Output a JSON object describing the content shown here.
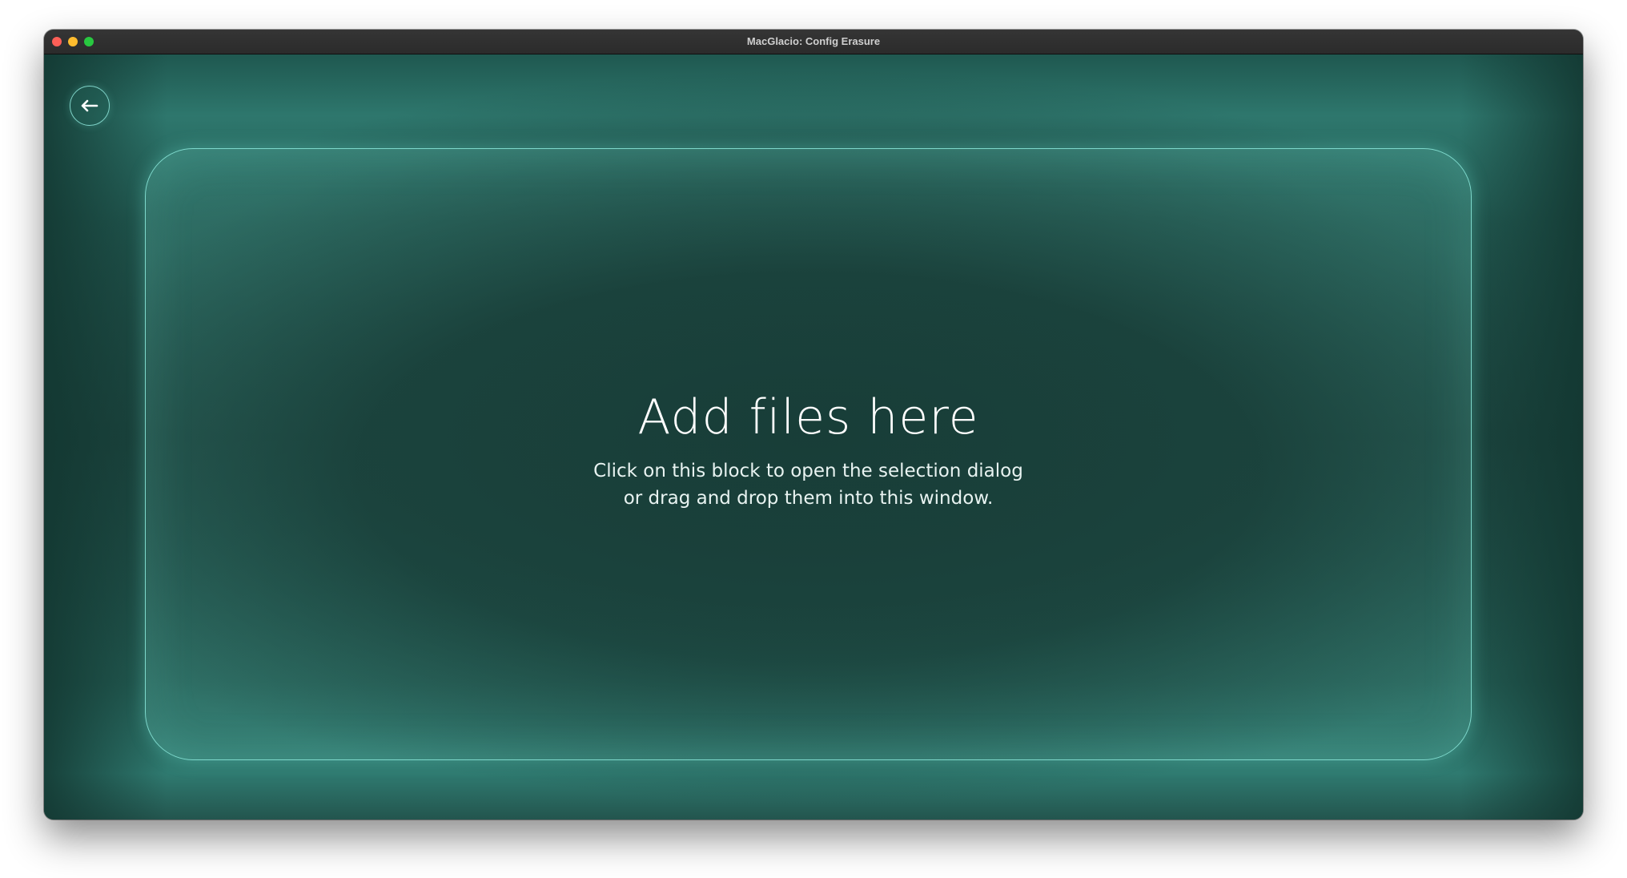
{
  "window": {
    "title": "MacGlacio: Config Erasure"
  },
  "toolbar": {
    "back_icon": "arrow-left-icon"
  },
  "drop_zone": {
    "title": "Add files here",
    "line1": "Click on this block to open the selection dialog",
    "line2": "or drag and drop them into this window."
  },
  "colors": {
    "accent": "#7ed9cc",
    "background": "#1b443e",
    "titlebar": "#2e2e2e"
  }
}
